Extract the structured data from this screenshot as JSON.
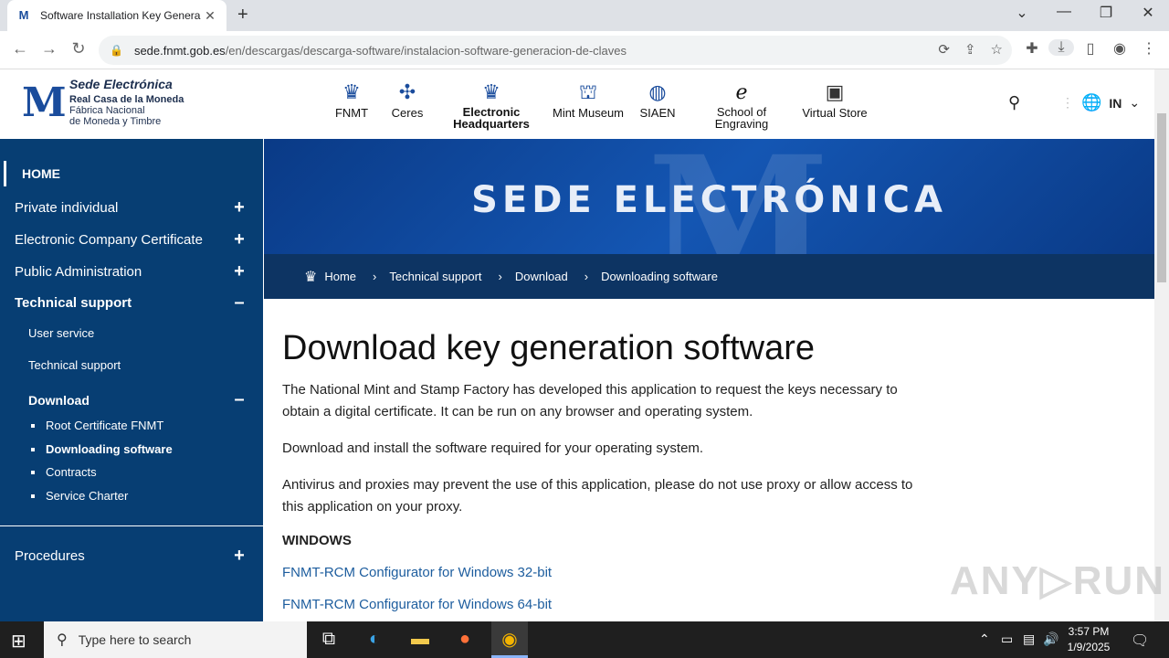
{
  "browser": {
    "tab_title": "Software Installation Key Genera",
    "url_domain": "sede.fnmt.gob.es",
    "url_path": "/en/descargas/descarga-software/instalacion-software-generacion-de-claves"
  },
  "logo": {
    "line1": "Sede Electrónica",
    "line2": "Real Casa de la Moneda",
    "line3": "Fábrica Nacional",
    "line4": "de Moneda y Timbre"
  },
  "topnav": [
    {
      "label": "FNMT",
      "icon": "crown-m-icon"
    },
    {
      "label": "Ceres",
      "icon": "ceres-icon"
    },
    {
      "label": "Electronic Headquarters",
      "icon": "crown-m-icon"
    },
    {
      "label": "Mint Museum",
      "icon": "museum-icon"
    },
    {
      "label": "SIAEN",
      "icon": "globe-seal-icon"
    },
    {
      "label": "School of Engraving",
      "icon": "engraving-e-icon"
    },
    {
      "label": "Virtual Store",
      "icon": "store-icon"
    }
  ],
  "lang": "IN",
  "sidebar": {
    "home": "HOME",
    "private": "Private individual",
    "company": "Electronic Company Certificate",
    "public_admin": "Public Administration",
    "tech_support": "Technical support",
    "user_service": "User service",
    "tech_support_sub": "Technical support",
    "download": "Download",
    "root_cert": "Root Certificate FNMT",
    "downloading_sw": "Downloading software",
    "contracts": "Contracts",
    "service_charter": "Service Charter",
    "procedures": "Procedures"
  },
  "banner_title": "SEDE ELECTRÓNICA",
  "breadcrumb": {
    "home": "Home",
    "c1": "Technical support",
    "c2": "Download",
    "c3": "Downloading software"
  },
  "content": {
    "title": "Download key generation software",
    "p1": "The National Mint and Stamp Factory has developed this application to request the keys necessary to obtain a digital certificate. It can be run on any browser and operating system.",
    "p2": "Download and install the software required for your operating system.",
    "p3": "Antivirus and proxies may prevent the use of this application, please do not use proxy or allow access to this application on your proxy.",
    "windows_heading": "WINDOWS",
    "link32": "FNMT-RCM Configurator for Windows 32-bit",
    "link64": "FNMT-RCM Configurator for Windows 64-bit"
  },
  "taskbar": {
    "search_placeholder": "Type here to search",
    "time": "3:57 PM",
    "date": "1/9/2025"
  }
}
